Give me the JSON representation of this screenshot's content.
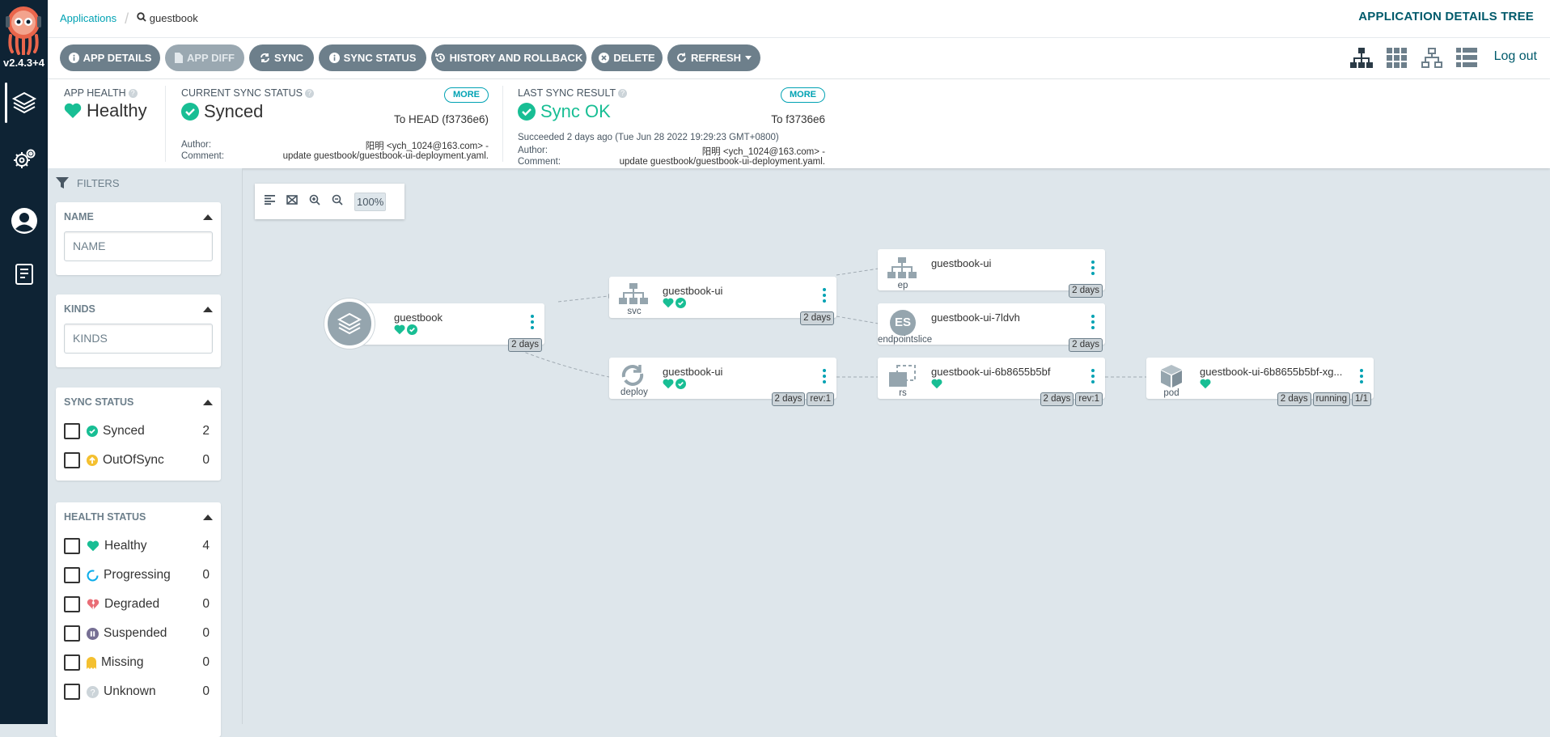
{
  "app": {
    "version": "v2.4.3+4"
  },
  "breadcrumb": {
    "root": "Applications",
    "current": "guestbook"
  },
  "page_title": "APPLICATION DETAILS TREE",
  "toolbar": {
    "app_details": "APP DETAILS",
    "app_diff": "APP DIFF",
    "sync": "SYNC",
    "sync_status": "SYNC STATUS",
    "history": "HISTORY AND ROLLBACK",
    "delete": "DELETE",
    "refresh": "REFRESH",
    "logout": "Log out"
  },
  "health": {
    "label": "APP HEALTH",
    "value": "Healthy"
  },
  "current_sync": {
    "label": "CURRENT SYNC STATUS",
    "more": "MORE",
    "value": "Synced",
    "target": "To HEAD (f3736e6)",
    "author_label": "Author:",
    "author": "阳明 <ych_1024@163.com> -",
    "comment_label": "Comment:",
    "comment": "update guestbook/guestbook-ui-deployment.yaml."
  },
  "last_sync": {
    "label": "LAST SYNC RESULT",
    "more": "MORE",
    "value": "Sync OK",
    "target": "To f3736e6",
    "succeeded": "Succeeded 2 days ago (Tue Jun 28 2022 19:29:23 GMT+0800)",
    "author_label": "Author:",
    "author": "阳明 <ych_1024@163.com> -",
    "comment_label": "Comment:",
    "comment": "update guestbook/guestbook-ui-deployment.yaml."
  },
  "filters": {
    "title": "FILTERS",
    "name": {
      "title": "NAME",
      "placeholder": "NAME"
    },
    "kinds": {
      "title": "KINDS",
      "placeholder": "KINDS"
    },
    "sync_status": {
      "title": "SYNC STATUS",
      "items": [
        {
          "label": "Synced",
          "count": "2"
        },
        {
          "label": "OutOfSync",
          "count": "0"
        }
      ]
    },
    "health_status": {
      "title": "HEALTH STATUS",
      "items": [
        {
          "label": "Healthy",
          "count": "4"
        },
        {
          "label": "Progressing",
          "count": "0"
        },
        {
          "label": "Degraded",
          "count": "0"
        },
        {
          "label": "Suspended",
          "count": "0"
        },
        {
          "label": "Missing",
          "count": "0"
        },
        {
          "label": "Unknown",
          "count": "0"
        }
      ]
    }
  },
  "zoom": "100%",
  "nodes": {
    "app": {
      "name": "guestbook",
      "age": "2 days"
    },
    "svc": {
      "name": "guestbook-ui",
      "kind": "svc",
      "age": "2 days"
    },
    "deploy": {
      "name": "guestbook-ui",
      "kind": "deploy",
      "age": "2 days",
      "rev": "rev:1"
    },
    "ep": {
      "name": "guestbook-ui",
      "kind": "ep",
      "age": "2 days"
    },
    "es": {
      "name": "guestbook-ui-7ldvh",
      "kind": "endpointslice",
      "badge": "ES",
      "age": "2 days"
    },
    "rs": {
      "name": "guestbook-ui-6b8655b5bf",
      "kind": "rs",
      "age": "2 days",
      "rev": "rev:1"
    },
    "pod": {
      "name": "guestbook-ui-6b8655b5bf-xg...",
      "kind": "pod",
      "age": "2 days",
      "state": "running",
      "ready": "1/1"
    }
  },
  "colors": {
    "healthy": "#18be94",
    "accent": "#00a2b3",
    "nav": "#0e2334",
    "outofsync": "#f4c030",
    "degraded": "#e96d76",
    "suspended": "#766f94"
  }
}
